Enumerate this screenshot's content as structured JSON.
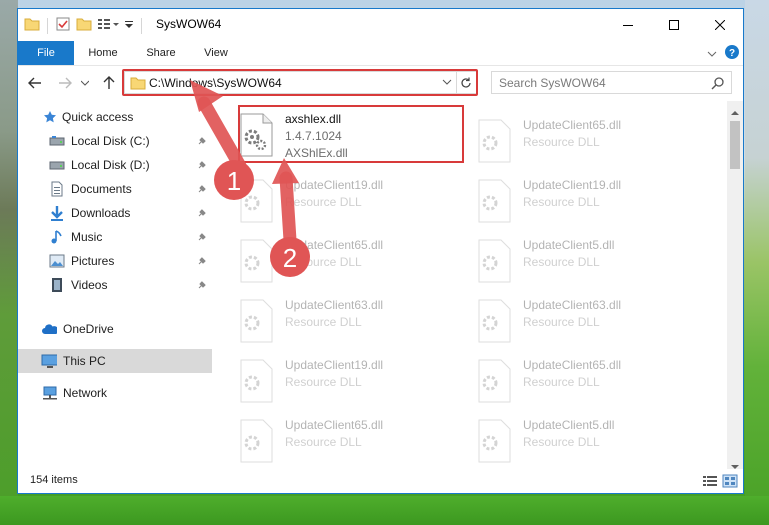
{
  "window": {
    "title": "SysWOW64",
    "controls": {
      "minimize": "—",
      "maximize": "☐",
      "close": "✕"
    }
  },
  "ribbon": {
    "tabs": [
      "File",
      "Home",
      "Share",
      "View"
    ]
  },
  "address": {
    "path": "C:\\Windows\\SysWOW64",
    "search_placeholder": "Search SysWOW64"
  },
  "nav": {
    "items": [
      {
        "label": "Quick access",
        "icon": "star-icon",
        "pinned": false
      },
      {
        "label": "Local Disk (C:)",
        "icon": "drive-icon",
        "pinned": true
      },
      {
        "label": "Local Disk (D:)",
        "icon": "drive-icon",
        "pinned": true
      },
      {
        "label": "Documents",
        "icon": "documents-icon",
        "pinned": true
      },
      {
        "label": "Downloads",
        "icon": "downloads-icon",
        "pinned": true
      },
      {
        "label": "Music",
        "icon": "music-icon",
        "pinned": true
      },
      {
        "label": "Pictures",
        "icon": "pictures-icon",
        "pinned": true
      },
      {
        "label": "Videos",
        "icon": "videos-icon",
        "pinned": true
      },
      {
        "label": "OneDrive",
        "icon": "cloud-icon",
        "pinned": false
      },
      {
        "label": "This PC",
        "icon": "computer-icon",
        "pinned": false,
        "selected": true
      },
      {
        "label": "Network",
        "icon": "network-icon",
        "pinned": false
      }
    ]
  },
  "files": {
    "highlighted": {
      "name": "axshlex.dll",
      "version": "1.4.7.1024",
      "description": "AXShlEx.dll"
    },
    "col1": [
      {
        "name": "UpdateClient19.dll",
        "type": "Resource DLL"
      },
      {
        "name": "UpdateClient65.dll",
        "type": "Resource DLL"
      },
      {
        "name": "UpdateClient63.dll",
        "type": "Resource DLL"
      },
      {
        "name": "UpdateClient19.dll",
        "type": "Resource DLL"
      },
      {
        "name": "UpdateClient65.dll",
        "type": "Resource DLL"
      }
    ],
    "col2": [
      {
        "name": "UpdateClient65.dll",
        "type": "Resource DLL"
      },
      {
        "name": "UpdateClient19.dll",
        "type": "Resource DLL"
      },
      {
        "name": "UpdateClient5.dll",
        "type": "Resource DLL"
      },
      {
        "name": "UpdateClient63.dll",
        "type": "Resource DLL"
      },
      {
        "name": "UpdateClient65.dll",
        "type": "Resource DLL"
      },
      {
        "name": "UpdateClient5.dll",
        "type": "Resource DLL"
      }
    ]
  },
  "status": {
    "count": "154 items"
  },
  "annotations": {
    "step1": "1",
    "step2": "2"
  },
  "colors": {
    "accent": "#1979ca",
    "highlight": "#d83a3a",
    "callout": "#e05555"
  }
}
